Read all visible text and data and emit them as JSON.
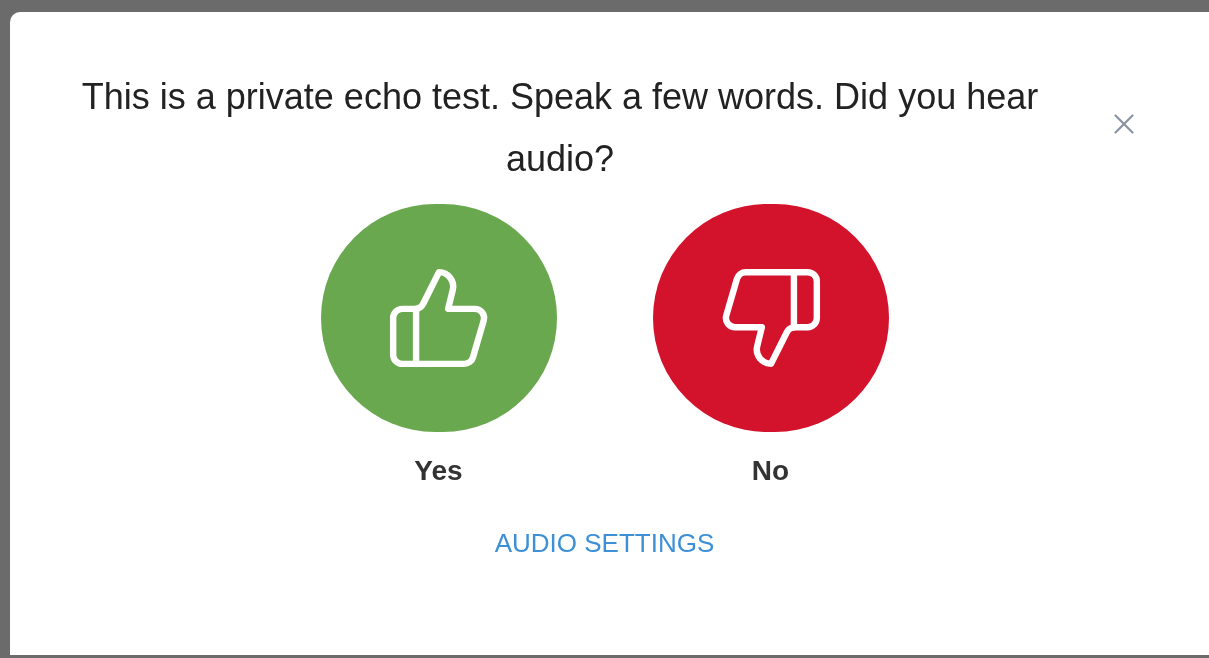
{
  "dialog": {
    "message": "This is a private echo test. Speak a few words. Did you hear audio?",
    "answers": [
      {
        "kind": "yes",
        "label": "Yes"
      },
      {
        "kind": "no",
        "label": "No"
      }
    ],
    "link": "AUDIO SETTINGS"
  }
}
